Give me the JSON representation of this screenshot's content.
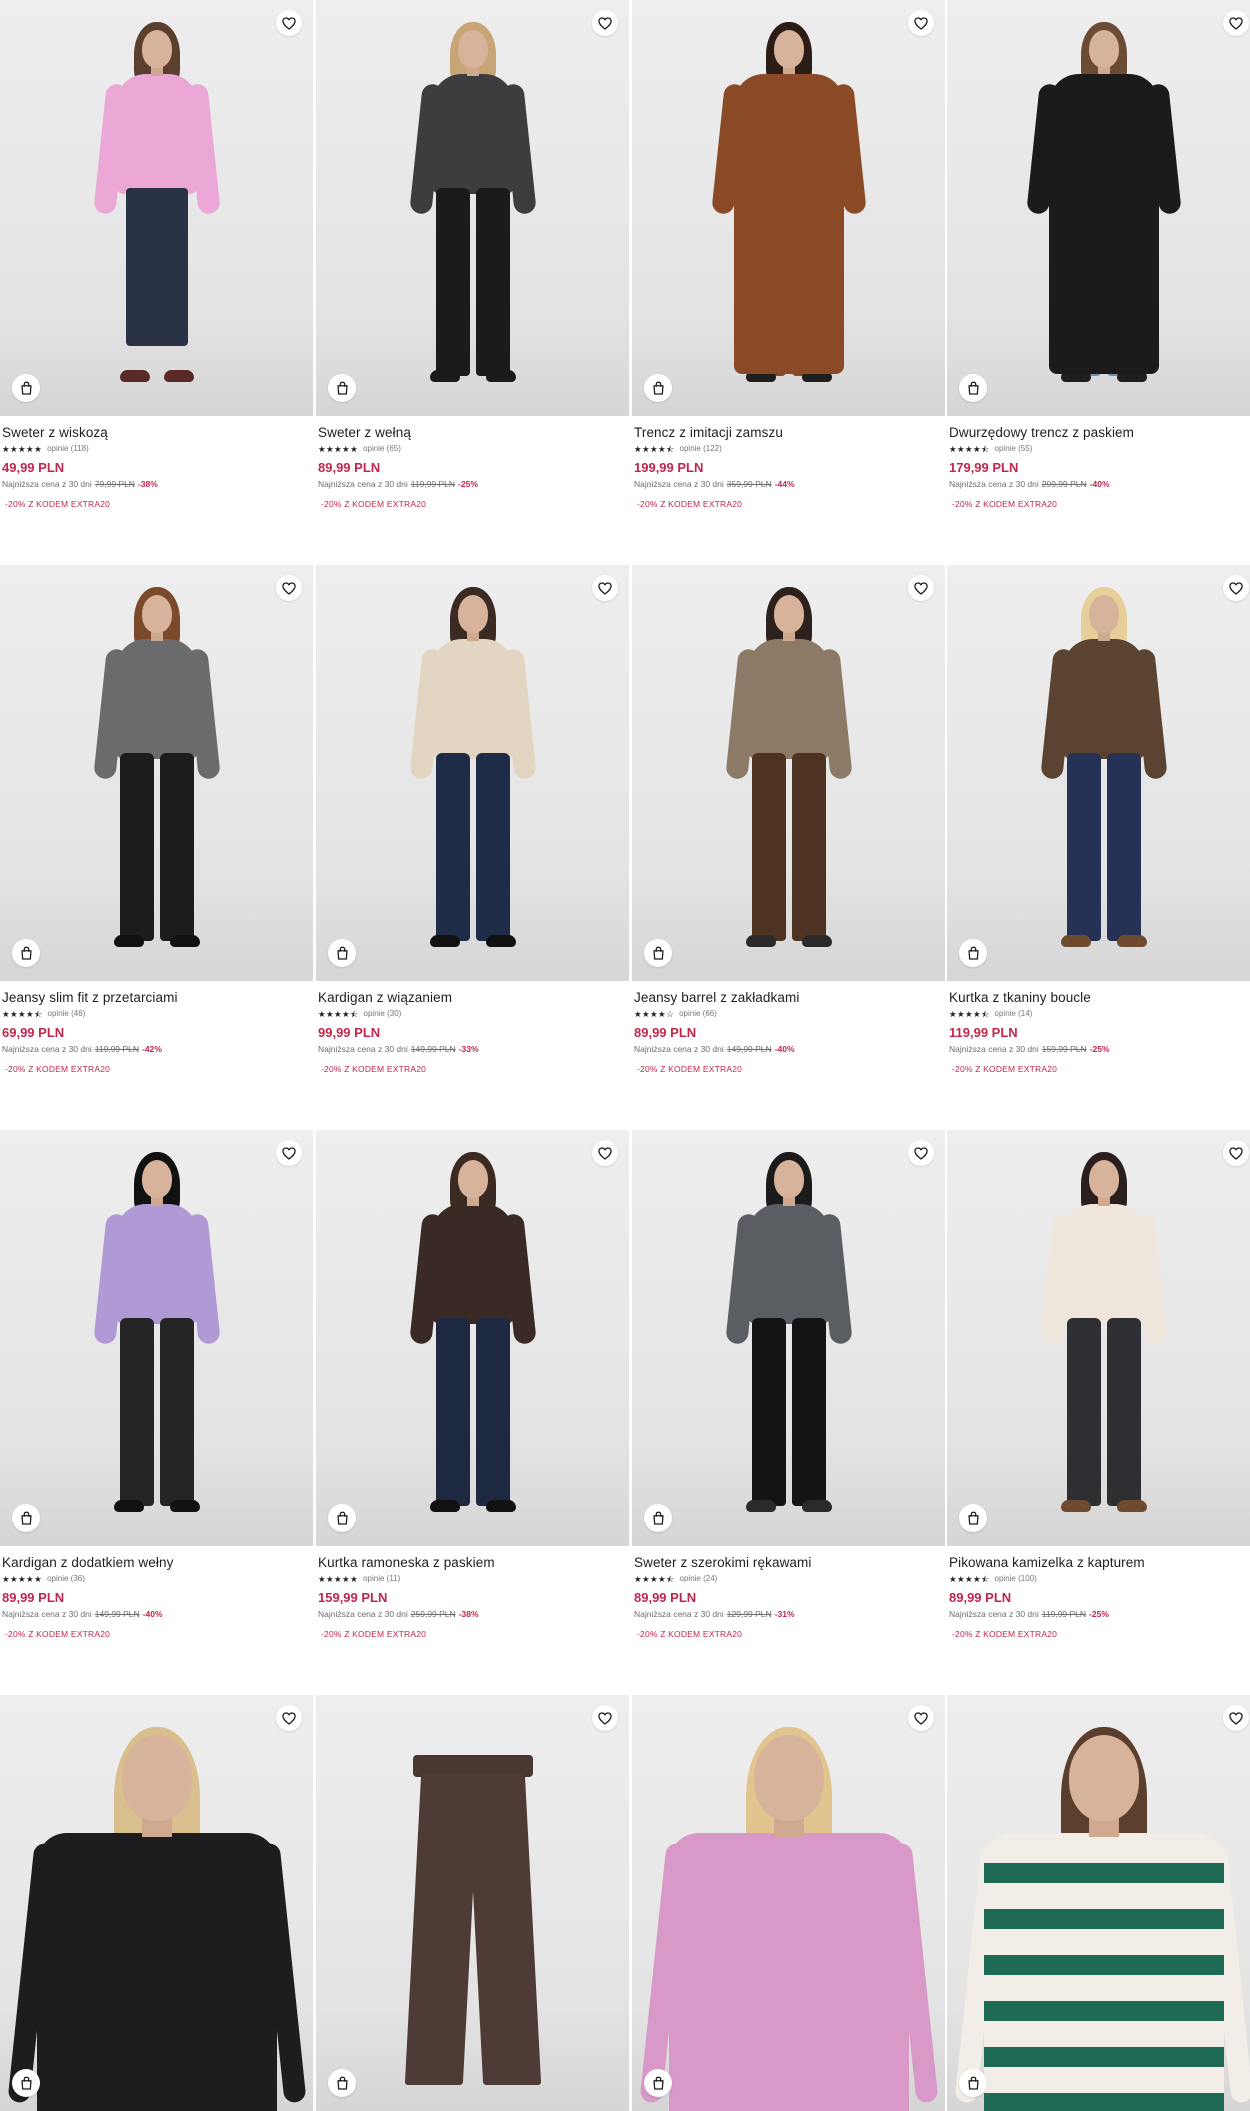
{
  "colors": {
    "price": "#c2264d",
    "promo": "#c2264d",
    "text": "#1e1e1e",
    "muted": "#6d6d6d"
  },
  "icons": {
    "wishlist": "heart-icon",
    "cart": "shopping-bag-icon",
    "rating": "star-icon"
  },
  "products": [
    {
      "name": "Sweter z wiskozą",
      "stars": "★★★★★",
      "reviews": "opinie (118)",
      "price": "49,99 PLN",
      "lowest_label": "Najniższa cena z 30 dni",
      "old_price": "79,99 PLN",
      "discount": "-38%",
      "promo": "-20% Z KODEM EXTRA20"
    },
    {
      "name": "Sweter z wełną",
      "stars": "★★★★★",
      "reviews": "opinie (65)",
      "price": "89,99 PLN",
      "lowest_label": "Najniższa cena z 30 dni",
      "old_price": "119,99 PLN",
      "discount": "-25%",
      "promo": "-20% Z KODEM EXTRA20"
    },
    {
      "name": "Trencz z imitacji zamszu",
      "stars": "★★★★⯪",
      "reviews": "opinie (122)",
      "price": "199,99 PLN",
      "lowest_label": "Najniższa cena z 30 dni",
      "old_price": "359,99 PLN",
      "discount": "-44%",
      "promo": "-20% Z KODEM EXTRA20"
    },
    {
      "name": "Dwurzędowy trencz z paskiem",
      "stars": "★★★★⯪",
      "reviews": "opinie (55)",
      "price": "179,99 PLN",
      "lowest_label": "Najniższa cena z 30 dni",
      "old_price": "299,99 PLN",
      "discount": "-40%",
      "promo": "-20% Z KODEM EXTRA20"
    },
    {
      "name": "Jeansy slim fit z przetarciami",
      "stars": "★★★★⯪",
      "reviews": "opinie (46)",
      "price": "69,99 PLN",
      "lowest_label": "Najniższa cena z 30 dni",
      "old_price": "119,99 PLN",
      "discount": "-42%",
      "promo": "-20% Z KODEM EXTRA20"
    },
    {
      "name": "Kardigan z wiązaniem",
      "stars": "★★★★⯪",
      "reviews": "opinie (30)",
      "price": "99,99 PLN",
      "lowest_label": "Najniższa cena z 30 dni",
      "old_price": "149,99 PLN",
      "discount": "-33%",
      "promo": "-20% Z KODEM EXTRA20"
    },
    {
      "name": "Jeansy barrel z zakładkami",
      "stars": "★★★★☆",
      "reviews": "opinie (66)",
      "price": "89,99 PLN",
      "lowest_label": "Najniższa cena z 30 dni",
      "old_price": "149,99 PLN",
      "discount": "-40%",
      "promo": "-20% Z KODEM EXTRA20"
    },
    {
      "name": "Kurtka z tkaniny boucle",
      "stars": "★★★★⯪",
      "reviews": "opinie (14)",
      "price": "119,99 PLN",
      "lowest_label": "Najniższa cena z 30 dni",
      "old_price": "159,99 PLN",
      "discount": "-25%",
      "promo": "-20% Z KODEM EXTRA20"
    },
    {
      "name": "Kardigan z dodatkiem wełny",
      "stars": "★★★★★",
      "reviews": "opinie (36)",
      "price": "89,99 PLN",
      "lowest_label": "Najniższa cena z 30 dni",
      "old_price": "149,99 PLN",
      "discount": "-40%",
      "promo": "-20% Z KODEM EXTRA20"
    },
    {
      "name": "Kurtka ramoneska z paskiem",
      "stars": "★★★★★",
      "reviews": "opinie (11)",
      "price": "159,99 PLN",
      "lowest_label": "Najniższa cena z 30 dni",
      "old_price": "259,99 PLN",
      "discount": "-38%",
      "promo": "-20% Z KODEM EXTRA20"
    },
    {
      "name": "Sweter z szerokimi rękawami",
      "stars": "★★★★⯪",
      "reviews": "opinie (24)",
      "price": "89,99 PLN",
      "lowest_label": "Najniższa cena z 30 dni",
      "old_price": "129,99 PLN",
      "discount": "-31%",
      "promo": "-20% Z KODEM EXTRA20"
    },
    {
      "name": "Pikowana kamizelka z kapturem",
      "stars": "★★★★⯪",
      "reviews": "opinie (100)",
      "price": "89,99 PLN",
      "lowest_label": "Najniższa cena z 30 dni",
      "old_price": "119,99 PLN",
      "discount": "-25%",
      "promo": "-20% Z KODEM EXTRA20"
    },
    {
      "name": "",
      "stars": "",
      "reviews": "",
      "price": "",
      "lowest_label": "",
      "old_price": "",
      "discount": "",
      "promo": ""
    },
    {
      "name": "",
      "stars": "",
      "reviews": "",
      "price": "",
      "lowest_label": "",
      "old_price": "",
      "discount": "",
      "promo": ""
    },
    {
      "name": "",
      "stars": "",
      "reviews": "",
      "price": "",
      "lowest_label": "",
      "old_price": "",
      "discount": "",
      "promo": ""
    },
    {
      "name": "",
      "stars": "",
      "reviews": "",
      "price": "",
      "lowest_label": "",
      "old_price": "",
      "discount": "",
      "promo": ""
    }
  ]
}
